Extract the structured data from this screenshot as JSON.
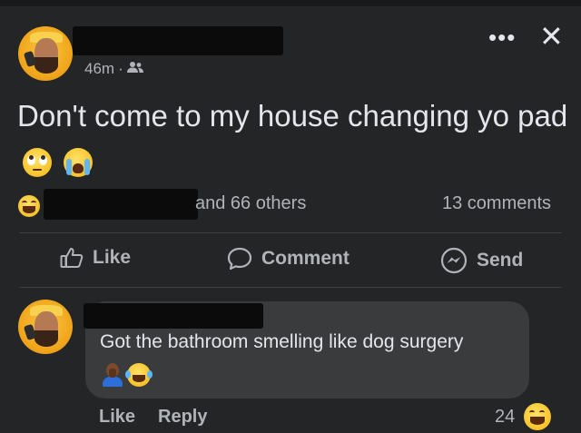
{
  "post": {
    "timestamp": "46m",
    "separator": "·",
    "audience_icon": "friends-icon",
    "text": "Don't come to my house changing yo pad",
    "emojis": [
      "face-with-rolling-eyes-icon",
      "loudly-crying-face-icon"
    ]
  },
  "header_controls": {
    "more_label": "•••",
    "close_label": "✕"
  },
  "reactions": {
    "emoji": "laughing-face-icon",
    "summary_suffix": "and 66 others",
    "comments_count": "13 comments"
  },
  "actions": {
    "like": "Like",
    "comment": "Comment",
    "send": "Send"
  },
  "comment": {
    "text": "Got the bathroom smelling like dog surgery",
    "emojis": [
      "man-facepalming-icon",
      "face-with-tears-of-joy-icon"
    ],
    "like_label": "Like",
    "reply_label": "Reply",
    "reaction_count": "24",
    "reaction_emoji": "laughing-face-icon"
  },
  "colors": {
    "background": "#242527",
    "bubble": "#3a3b3c",
    "text": "#e4e6eb",
    "secondary_text": "#b0b3b8",
    "emoji_yellow": "#f7c22a"
  }
}
